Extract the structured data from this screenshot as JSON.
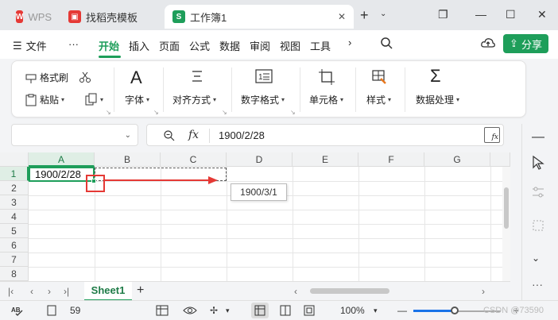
{
  "tabs": {
    "wps": "WPS",
    "templates": "找稻壳模板",
    "workbook": "工作簿1",
    "sheet_logo": "S"
  },
  "menu": {
    "file": "文件",
    "more": "···",
    "items": [
      "开始",
      "插入",
      "页面",
      "公式",
      "数据",
      "审阅",
      "视图",
      "工具"
    ],
    "share": "分享"
  },
  "ribbon": {
    "format_painter": "格式刷",
    "paste": "粘贴",
    "font": "字体",
    "align": "对齐方式",
    "number_format": "数字格式",
    "cell": "单元格",
    "style": "样式",
    "data_process": "数据处理"
  },
  "formula_bar": {
    "namebox": "",
    "fx": "fx",
    "content": "1900/2/28",
    "fx_box": "fx"
  },
  "grid": {
    "columns": [
      "A",
      "B",
      "C",
      "D",
      "E",
      "F",
      "G"
    ],
    "rows": [
      "1",
      "2",
      "3",
      "4",
      "5",
      "6",
      "7",
      "8"
    ],
    "a1_value": "1900/2/28",
    "fill_tooltip": "1900/3/1",
    "selected_column": "A",
    "selected_row": "1"
  },
  "sheets": {
    "tabs": [
      "Sheet1"
    ],
    "add": "+"
  },
  "status": {
    "count": "59",
    "zoom": "100%",
    "watermark": "CSDN @73590"
  },
  "colors": {
    "accent": "#1e9e5a",
    "highlight_red": "#e53935"
  }
}
